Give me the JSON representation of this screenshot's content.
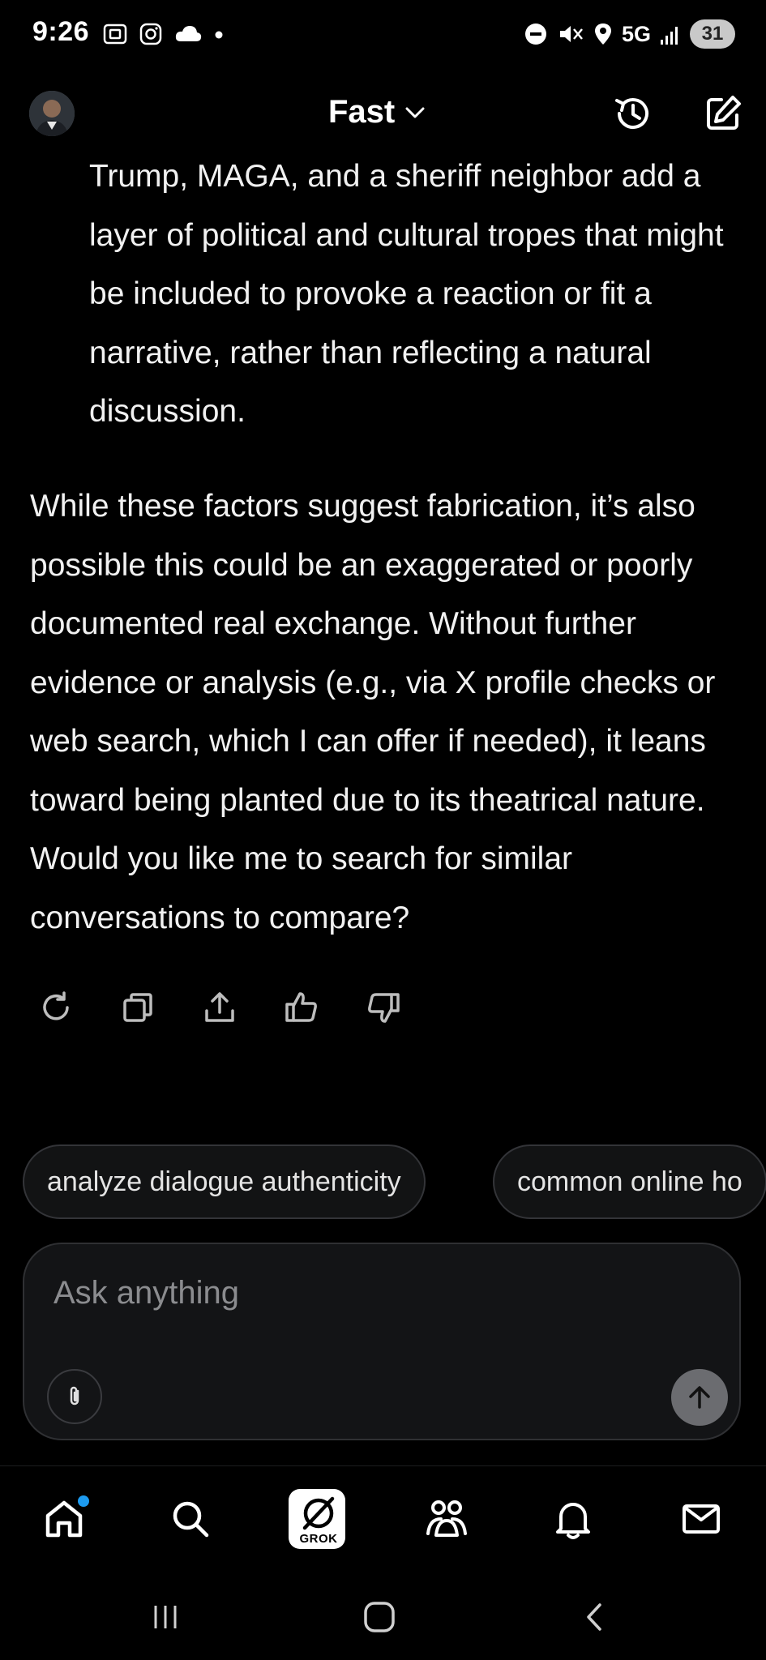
{
  "status_bar": {
    "time": "9:26",
    "network": "5G",
    "battery": "31"
  },
  "header": {
    "model_label": "Fast"
  },
  "message": {
    "bullet_tail": "Trump, MAGA, and a sheriff neighbor add a layer of political and cultural tropes that might be included to provoke a reaction or fit a narrative, rather than reflecting a natural discussion.",
    "paragraph": "While these factors suggest fabrication, it’s also possible this could be an exaggerated or poorly documented real exchange. Without further evidence or analysis (e.g., via X profile checks or web search, which I can offer if needed), it leans toward being planted due to its theatrical nature. Would you like me to search for similar conversations to compare?"
  },
  "actions": [
    "regenerate-icon",
    "copy-icon",
    "share-icon",
    "thumbs-up-icon",
    "thumbs-down-icon"
  ],
  "suggestions": [
    "analyze dialogue authenticity",
    "common online ho"
  ],
  "composer": {
    "placeholder": "Ask anything"
  },
  "bottom_nav": {
    "grok_label": "GROK",
    "items": [
      "home-icon",
      "search-icon",
      "grok-icon",
      "communities-icon",
      "notifications-icon",
      "messages-icon"
    ]
  },
  "colors": {
    "background": "#000000",
    "text": "#f1f1f1",
    "chip_border": "#333438",
    "composer_bg": "#131416",
    "send_button": "#6b6c70",
    "notification_dot": "#1d9bf0"
  }
}
